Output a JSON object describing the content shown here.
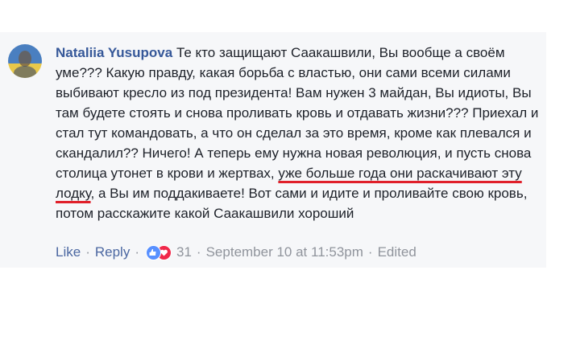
{
  "comment": {
    "author": "Nataliia Yusupova",
    "text_before": "Те кто защищают Саакашвили, Вы вообще а своём уме??? Какую правду, какая борьба с властью, они сами всеми силами выбивают кресло из под президента! Вам нужен 3 майдан, Вы идиоты, Вы там будете стоять и снова проливать кровь и отдавать жизни??? Приехал и стал тут командовать, а что он сделал за это время, кроме как плевался и скандалил?? Ничего! А теперь ему нужна новая революция, и пусть снова столица утонет в крови и жертвах,",
    "text_highlight": "уже больше года они раскачивают эту лодку",
    "text_after": ", а Вы им поддакиваете! Вот сами и идите и проливайте свою кровь, потом расскажите какой Саакашвили хороший",
    "highlight_color": "#e0202a"
  },
  "actions": {
    "like_label": "Like",
    "separator": "·",
    "reply_label": "Reply",
    "reactions": [
      "like-icon",
      "love-icon"
    ],
    "reaction_count": "31",
    "timestamp": "September 10 at 11:53pm",
    "edited_label": "Edited"
  },
  "colors": {
    "author": "#365899",
    "action_link": "#4b67a1",
    "meta": "#90949c",
    "card_background": "#f6f7f9"
  }
}
